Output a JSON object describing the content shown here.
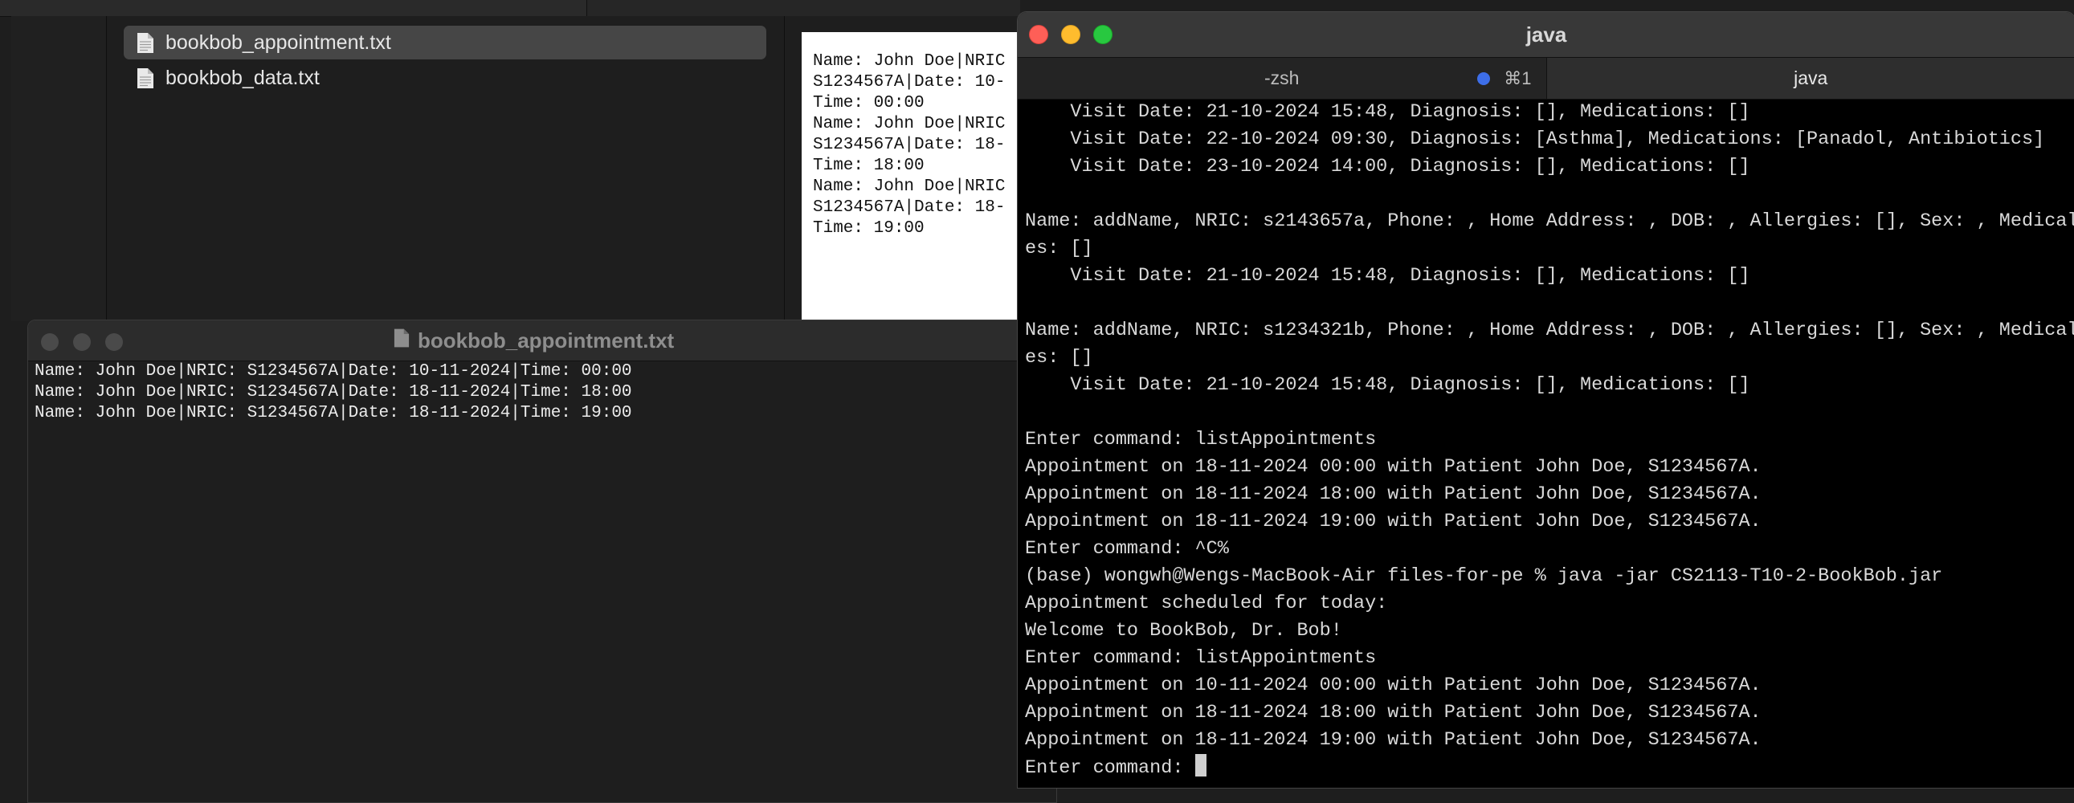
{
  "finder": {
    "files": [
      {
        "name": "bookbob_appointment.txt",
        "selected": true
      },
      {
        "name": "bookbob_data.txt",
        "selected": false
      }
    ],
    "preview_lines": [
      "Name: John Doe|NRIC",
      "S1234567A|Date: 10-",
      "Time: 00:00",
      "Name: John Doe|NRIC",
      "S1234567A|Date: 18-",
      "Time: 18:00",
      "Name: John Doe|NRIC",
      "S1234567A|Date: 18-",
      "Time: 19:00"
    ]
  },
  "textedit": {
    "title": "bookbob_appointment.txt",
    "lines": [
      "Name: John Doe|NRIC: S1234567A|Date: 10-11-2024|Time: 00:00",
      "Name: John Doe|NRIC: S1234567A|Date: 18-11-2024|Time: 18:00",
      "Name: John Doe|NRIC: S1234567A|Date: 18-11-2024|Time: 19:00"
    ]
  },
  "terminal": {
    "title": "java",
    "tabs": [
      {
        "label": "-zsh",
        "shortcut": "⌘1",
        "active": false
      },
      {
        "label": "java",
        "shortcut": "",
        "active": true
      }
    ],
    "lines": [
      "    Visit Date: 21-10-2024 15:48, Diagnosis: [], Medications: []",
      "    Visit Date: 22-10-2024 09:30, Diagnosis: [Asthma], Medications: [Panadol, Antibiotics]",
      "    Visit Date: 23-10-2024 14:00, Diagnosis: [], Medications: []",
      "",
      "Name: addName, NRIC: s2143657a, Phone: , Home Address: , DOB: , Allergies: [], Sex: , Medical",
      "es: []",
      "    Visit Date: 21-10-2024 15:48, Diagnosis: [], Medications: []",
      "",
      "Name: addName, NRIC: s1234321b, Phone: , Home Address: , DOB: , Allergies: [], Sex: , Medical",
      "es: []",
      "    Visit Date: 21-10-2024 15:48, Diagnosis: [], Medications: []",
      "",
      "Enter command: listAppointments",
      "Appointment on 18-11-2024 00:00 with Patient John Doe, S1234567A.",
      "Appointment on 18-11-2024 18:00 with Patient John Doe, S1234567A.",
      "Appointment on 18-11-2024 19:00 with Patient John Doe, S1234567A.",
      "Enter command: ^C%",
      "(base) wongwh@Wengs-MacBook-Air files-for-pe % java -jar CS2113-T10-2-BookBob.jar",
      "Appointment scheduled for today:",
      "Welcome to BookBob, Dr. Bob!",
      "Enter command: listAppointments",
      "Appointment on 10-11-2024 00:00 with Patient John Doe, S1234567A.",
      "Appointment on 18-11-2024 18:00 with Patient John Doe, S1234567A.",
      "Appointment on 18-11-2024 19:00 with Patient John Doe, S1234567A."
    ],
    "prompt": "Enter command: "
  }
}
